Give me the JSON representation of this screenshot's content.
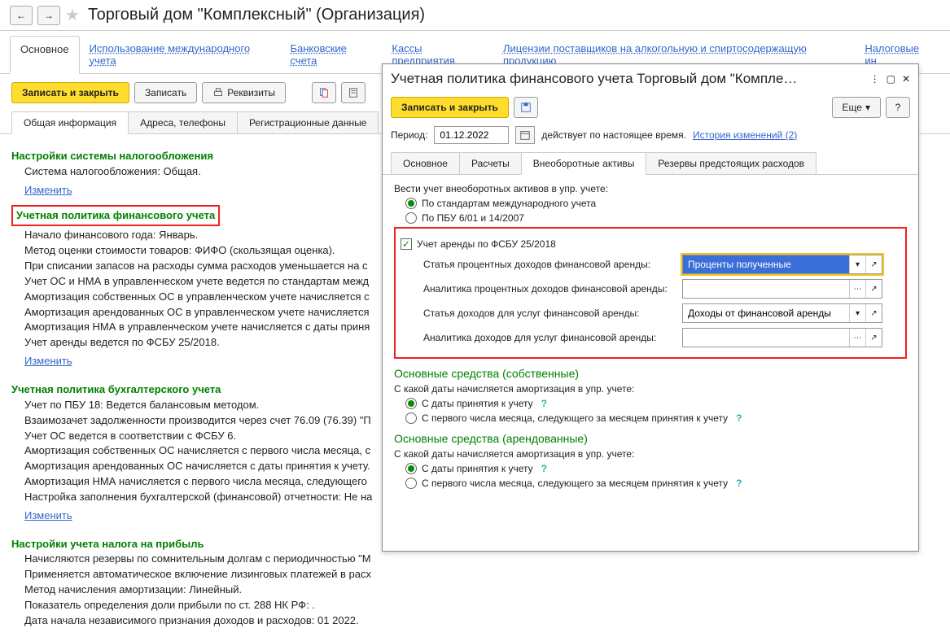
{
  "header": {
    "title": "Торговый дом \"Комплексный\" (Организация)"
  },
  "tabbar": {
    "main": "Основное",
    "intl": "Использование международного учета",
    "bank": "Банковские счета",
    "cash": "Кассы предприятия",
    "lic": "Лицензии поставщиков на алкогольную и спиртосодержащую продукцию",
    "tax": "Налоговые ин"
  },
  "toolbar": {
    "save_close": "Записать и закрыть",
    "save": "Записать",
    "rekvizity": "Реквизиты"
  },
  "subtabs": {
    "general": "Общая информация",
    "address": "Адреса, телефоны",
    "reg": "Регистрационные данные"
  },
  "sections": {
    "tax": {
      "h": "Настройки системы налогообложения",
      "line1": "Система налогообложения: Общая.",
      "change": "Изменить"
    },
    "fin": {
      "h": "Учетная политика финансового учета",
      "l1": "Начало финансового года: Январь.",
      "l2": "Метод оценки стоимости товаров: ФИФО (скользящая оценка).",
      "l3": "При списании запасов на расходы сумма расходов уменьшается на с",
      "l4": "Учет ОС и НМА в управленческом учете ведется по стандартам межд",
      "l5": "Амортизация собственных ОС в управленческом учете начисляется с",
      "l6": "Амортизация арендованных ОС в управленческом учете начисляется",
      "l7": "Амортизация НМА в управленческом учете начисляется с даты приня",
      "l8": "Учет аренды ведется по ФСБУ 25/2018.",
      "change": "Изменить"
    },
    "buh": {
      "h": "Учетная политика бухгалтерского учета",
      "l1": "Учет по ПБУ 18: Ведется балансовым методом.",
      "l2": "Взаимозачет задолженности производится через счет 76.09 (76.39) \"П",
      "l3": "Учет ОС ведется в соответствии с ФСБУ 6.",
      "l4": "Амортизация собственных ОС начисляется с первого числа месяца, с",
      "l5": "Амортизация арендованных ОС начисляется с даты принятия к учету.",
      "l6": "Амортизация НМА начисляется с первого числа месяца, следующего",
      "l7": "Настройка заполнения бухгалтерской (финансовой)  отчетности: Не на",
      "change": "Изменить"
    },
    "profit": {
      "h": "Настройки учета налога на прибыль",
      "l1": "Начисляются резервы по сомнительным долгам с периодичностью \"М",
      "l2": "Применяется автоматическое включение лизинговых платежей в расх",
      "l3": "Метод начисления амортизации: Линейный.",
      "l4": "Показатель определения доли прибыли по ст. 288 НК РФ: .",
      "l5": "Дата начала независимого признания доходов и расходов: 01 2022."
    }
  },
  "popup": {
    "title": "Учетная политика финансового учета Торговый дом \"Компле…",
    "save_close": "Записать и закрыть",
    "more": "Еще",
    "period_lbl": "Период:",
    "period_val": "01.12.2022",
    "period_info": "действует по настоящее время.",
    "history": "История изменений (2)",
    "tabs": {
      "main": "Основное",
      "calc": "Расчеты",
      "assets": "Внеоборотные активы",
      "reserves": "Резервы предстоящих расходов"
    },
    "assets_prompt": "Вести учет внеоборотных активов в упр. учете:",
    "radio1": "По стандартам международного учета",
    "radio2": "По ПБУ 6/01 и 14/2007",
    "lease_check": "Учет аренды по ФСБУ 25/2018",
    "frm": {
      "f1": "Статья процентных доходов финансовой аренды:",
      "f1v": "Проценты полученные",
      "f2": "Аналитика процентных доходов финансовой аренды:",
      "f2v": "",
      "f3": "Статья доходов для услуг финансовой аренды:",
      "f3v": "Доходы от финансовой аренды",
      "f4": "Аналитика доходов для услуг финансовой аренды:",
      "f4v": ""
    },
    "own": {
      "h": "Основные средства (собственные)",
      "q": "С какой даты начисляется амортизация в упр. учете:",
      "r1": "С даты принятия к учету",
      "r2": "С первого числа месяца, следующего за месяцем принятия к учету"
    },
    "rent": {
      "h": "Основные средства (арендованные)",
      "q": "С какой даты начисляется амортизация в упр. учете:",
      "r1": "С даты принятия к учету",
      "r2": "С первого числа месяца, следующего за месяцем принятия к учету"
    }
  }
}
